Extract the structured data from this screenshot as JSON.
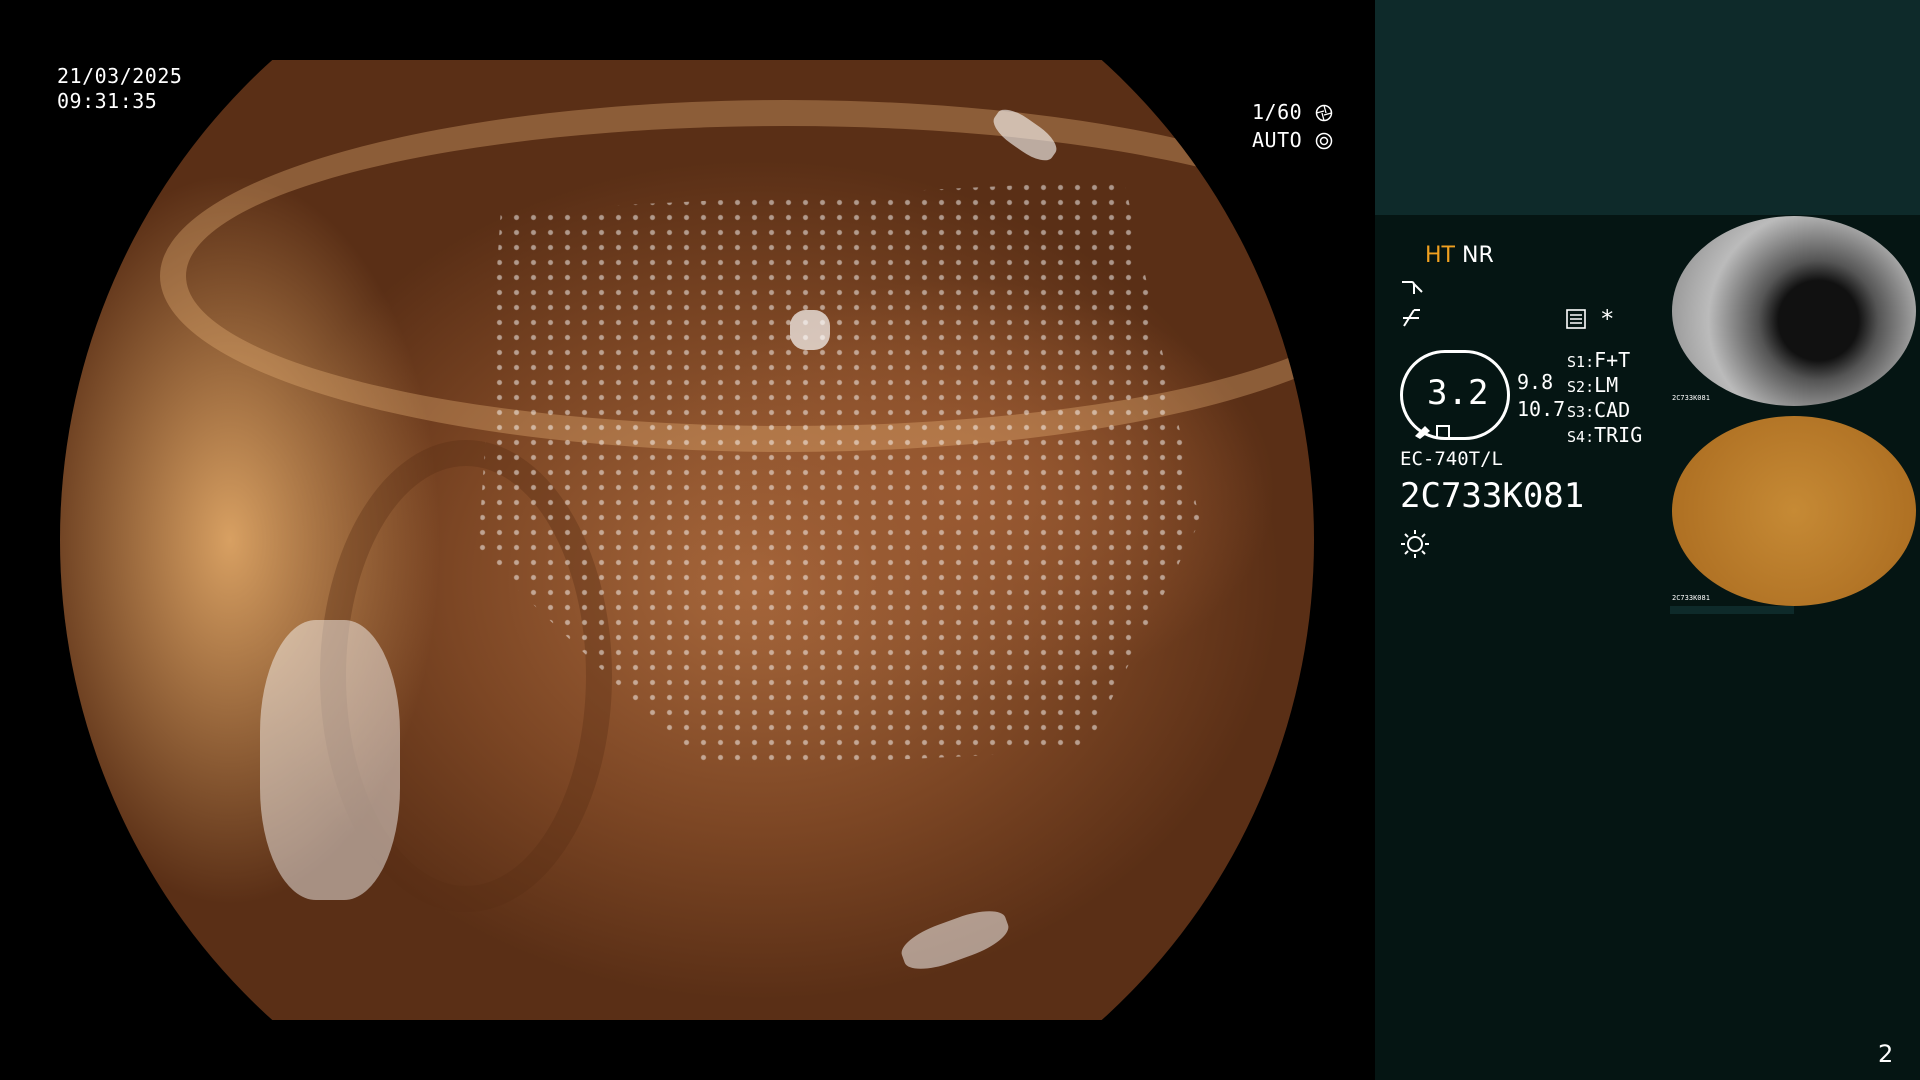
{
  "osd": {
    "date": "21/03/2025",
    "time": "09:31:35",
    "shutter": "1/60",
    "iris": "AUTO"
  },
  "panel": {
    "ht": "HT",
    "nr": "NR",
    "zoom_value": "3.2",
    "val_a": "9.8",
    "val_b": "10.7",
    "switches": [
      {
        "key": "S1",
        "value": "F+T"
      },
      {
        "key": "S2",
        "value": "LM"
      },
      {
        "key": "S3",
        "value": "CAD"
      },
      {
        "key": "S4",
        "value": "TRIG"
      }
    ],
    "asterisk": "*",
    "scope_model": "EC-740T/L",
    "serial": "2C733K081",
    "page_number": "2"
  },
  "thumbnails": [
    {
      "label": "2C733K081"
    },
    {
      "label": "2C733K081"
    }
  ],
  "icons": [
    "shutter-icon",
    "iris-icon",
    "curve-icon",
    "enhance-icon",
    "menu-icon",
    "brightness-icon",
    "pen-icon"
  ],
  "colors": {
    "accent_orange": "#f0a020",
    "panel_bg": "#051513",
    "panel_top": "#0e2a2a"
  }
}
